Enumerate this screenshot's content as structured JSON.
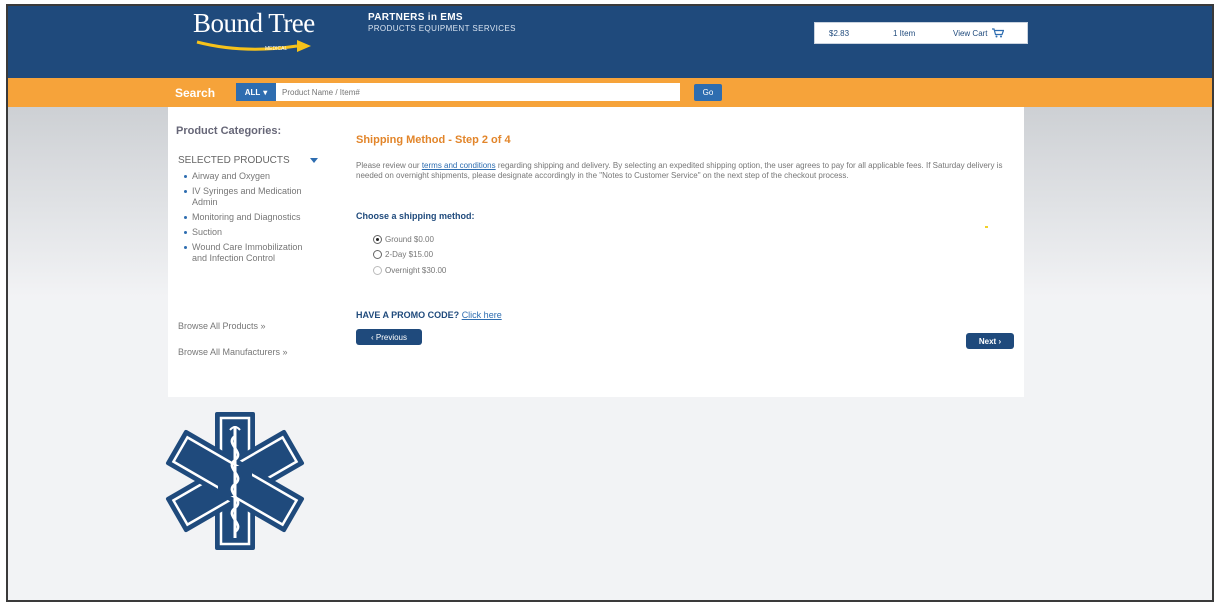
{
  "header": {
    "logo_text": "Bound Tree",
    "logo_sub": "MEDICAL",
    "tagline_1": "PARTNERS in EMS",
    "tagline_2": "PRODUCTS EQUIPMENT SERVICES",
    "cart": {
      "total": "$2.83",
      "items": "1 Item",
      "view_cart": "View Cart"
    }
  },
  "search": {
    "label": "Search",
    "scope": "ALL",
    "placeholder": "Product Name / Item#",
    "go": "Go"
  },
  "sidebar": {
    "title": "Product Categories:",
    "selected": "SELECTED PRODUCTS",
    "categories": [
      "Airway and Oxygen",
      "IV Syringes and Medication Admin",
      "Monitoring and Diagnostics",
      "Suction",
      "Wound Care Immobilization and Infection Control"
    ],
    "browse_products": "Browse All Products »",
    "browse_manufacturers": "Browse All Manufacturers »"
  },
  "main": {
    "step_title": "Shipping Method - Step 2 of 4",
    "notice_pre": "Please review our ",
    "notice_link": "terms and conditions",
    "notice_post": " regarding shipping and delivery. By selecting an expedited shipping option, the user agrees to pay for all applicable fees. If Saturday delivery is needed on overnight shipments, please designate accordingly in the \"Notes to Customer Service\" on the next step of the checkout process.",
    "choose_label": "Choose a shipping method:",
    "options": [
      {
        "label": "Ground $0.00",
        "selected": true
      },
      {
        "label": "2-Day $15.00",
        "selected": false
      },
      {
        "label": "Overnight $30.00",
        "selected": false
      }
    ],
    "promo_label": "HAVE A PROMO CODE?",
    "promo_link": "Click here",
    "previous": "‹ Previous",
    "next": "Next ›"
  },
  "colors": {
    "header_blue": "#1f4a7c",
    "search_orange": "#f6a33a",
    "accent_blue": "#2e6db0",
    "title_orange": "#e2852a"
  },
  "icons": [
    "cart-icon",
    "dropdown-triangle-icon",
    "star-of-life-icon"
  ]
}
